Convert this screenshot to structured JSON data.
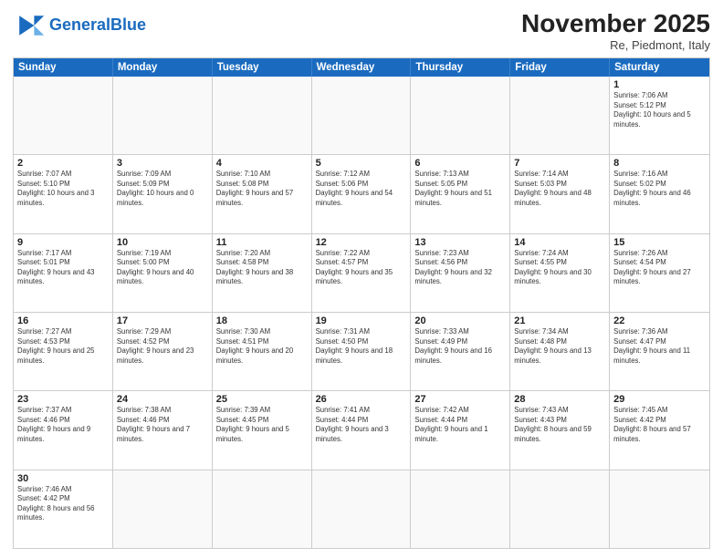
{
  "header": {
    "logo_general": "General",
    "logo_blue": "Blue",
    "month_title": "November 2025",
    "subtitle": "Re, Piedmont, Italy"
  },
  "weekdays": [
    "Sunday",
    "Monday",
    "Tuesday",
    "Wednesday",
    "Thursday",
    "Friday",
    "Saturday"
  ],
  "rows": [
    [
      {
        "day": "",
        "info": ""
      },
      {
        "day": "",
        "info": ""
      },
      {
        "day": "",
        "info": ""
      },
      {
        "day": "",
        "info": ""
      },
      {
        "day": "",
        "info": ""
      },
      {
        "day": "",
        "info": ""
      },
      {
        "day": "1",
        "info": "Sunrise: 7:06 AM\nSunset: 5:12 PM\nDaylight: 10 hours and 5 minutes."
      }
    ],
    [
      {
        "day": "2",
        "info": "Sunrise: 7:07 AM\nSunset: 5:10 PM\nDaylight: 10 hours and 3 minutes."
      },
      {
        "day": "3",
        "info": "Sunrise: 7:09 AM\nSunset: 5:09 PM\nDaylight: 10 hours and 0 minutes."
      },
      {
        "day": "4",
        "info": "Sunrise: 7:10 AM\nSunset: 5:08 PM\nDaylight: 9 hours and 57 minutes."
      },
      {
        "day": "5",
        "info": "Sunrise: 7:12 AM\nSunset: 5:06 PM\nDaylight: 9 hours and 54 minutes."
      },
      {
        "day": "6",
        "info": "Sunrise: 7:13 AM\nSunset: 5:05 PM\nDaylight: 9 hours and 51 minutes."
      },
      {
        "day": "7",
        "info": "Sunrise: 7:14 AM\nSunset: 5:03 PM\nDaylight: 9 hours and 48 minutes."
      },
      {
        "day": "8",
        "info": "Sunrise: 7:16 AM\nSunset: 5:02 PM\nDaylight: 9 hours and 46 minutes."
      }
    ],
    [
      {
        "day": "9",
        "info": "Sunrise: 7:17 AM\nSunset: 5:01 PM\nDaylight: 9 hours and 43 minutes."
      },
      {
        "day": "10",
        "info": "Sunrise: 7:19 AM\nSunset: 5:00 PM\nDaylight: 9 hours and 40 minutes."
      },
      {
        "day": "11",
        "info": "Sunrise: 7:20 AM\nSunset: 4:58 PM\nDaylight: 9 hours and 38 minutes."
      },
      {
        "day": "12",
        "info": "Sunrise: 7:22 AM\nSunset: 4:57 PM\nDaylight: 9 hours and 35 minutes."
      },
      {
        "day": "13",
        "info": "Sunrise: 7:23 AM\nSunset: 4:56 PM\nDaylight: 9 hours and 32 minutes."
      },
      {
        "day": "14",
        "info": "Sunrise: 7:24 AM\nSunset: 4:55 PM\nDaylight: 9 hours and 30 minutes."
      },
      {
        "day": "15",
        "info": "Sunrise: 7:26 AM\nSunset: 4:54 PM\nDaylight: 9 hours and 27 minutes."
      }
    ],
    [
      {
        "day": "16",
        "info": "Sunrise: 7:27 AM\nSunset: 4:53 PM\nDaylight: 9 hours and 25 minutes."
      },
      {
        "day": "17",
        "info": "Sunrise: 7:29 AM\nSunset: 4:52 PM\nDaylight: 9 hours and 23 minutes."
      },
      {
        "day": "18",
        "info": "Sunrise: 7:30 AM\nSunset: 4:51 PM\nDaylight: 9 hours and 20 minutes."
      },
      {
        "day": "19",
        "info": "Sunrise: 7:31 AM\nSunset: 4:50 PM\nDaylight: 9 hours and 18 minutes."
      },
      {
        "day": "20",
        "info": "Sunrise: 7:33 AM\nSunset: 4:49 PM\nDaylight: 9 hours and 16 minutes."
      },
      {
        "day": "21",
        "info": "Sunrise: 7:34 AM\nSunset: 4:48 PM\nDaylight: 9 hours and 13 minutes."
      },
      {
        "day": "22",
        "info": "Sunrise: 7:36 AM\nSunset: 4:47 PM\nDaylight: 9 hours and 11 minutes."
      }
    ],
    [
      {
        "day": "23",
        "info": "Sunrise: 7:37 AM\nSunset: 4:46 PM\nDaylight: 9 hours and 9 minutes."
      },
      {
        "day": "24",
        "info": "Sunrise: 7:38 AM\nSunset: 4:46 PM\nDaylight: 9 hours and 7 minutes."
      },
      {
        "day": "25",
        "info": "Sunrise: 7:39 AM\nSunset: 4:45 PM\nDaylight: 9 hours and 5 minutes."
      },
      {
        "day": "26",
        "info": "Sunrise: 7:41 AM\nSunset: 4:44 PM\nDaylight: 9 hours and 3 minutes."
      },
      {
        "day": "27",
        "info": "Sunrise: 7:42 AM\nSunset: 4:44 PM\nDaylight: 9 hours and 1 minute."
      },
      {
        "day": "28",
        "info": "Sunrise: 7:43 AM\nSunset: 4:43 PM\nDaylight: 8 hours and 59 minutes."
      },
      {
        "day": "29",
        "info": "Sunrise: 7:45 AM\nSunset: 4:42 PM\nDaylight: 8 hours and 57 minutes."
      }
    ],
    [
      {
        "day": "30",
        "info": "Sunrise: 7:46 AM\nSunset: 4:42 PM\nDaylight: 8 hours and 56 minutes."
      },
      {
        "day": "",
        "info": ""
      },
      {
        "day": "",
        "info": ""
      },
      {
        "day": "",
        "info": ""
      },
      {
        "day": "",
        "info": ""
      },
      {
        "day": "",
        "info": ""
      },
      {
        "day": "",
        "info": ""
      }
    ]
  ]
}
